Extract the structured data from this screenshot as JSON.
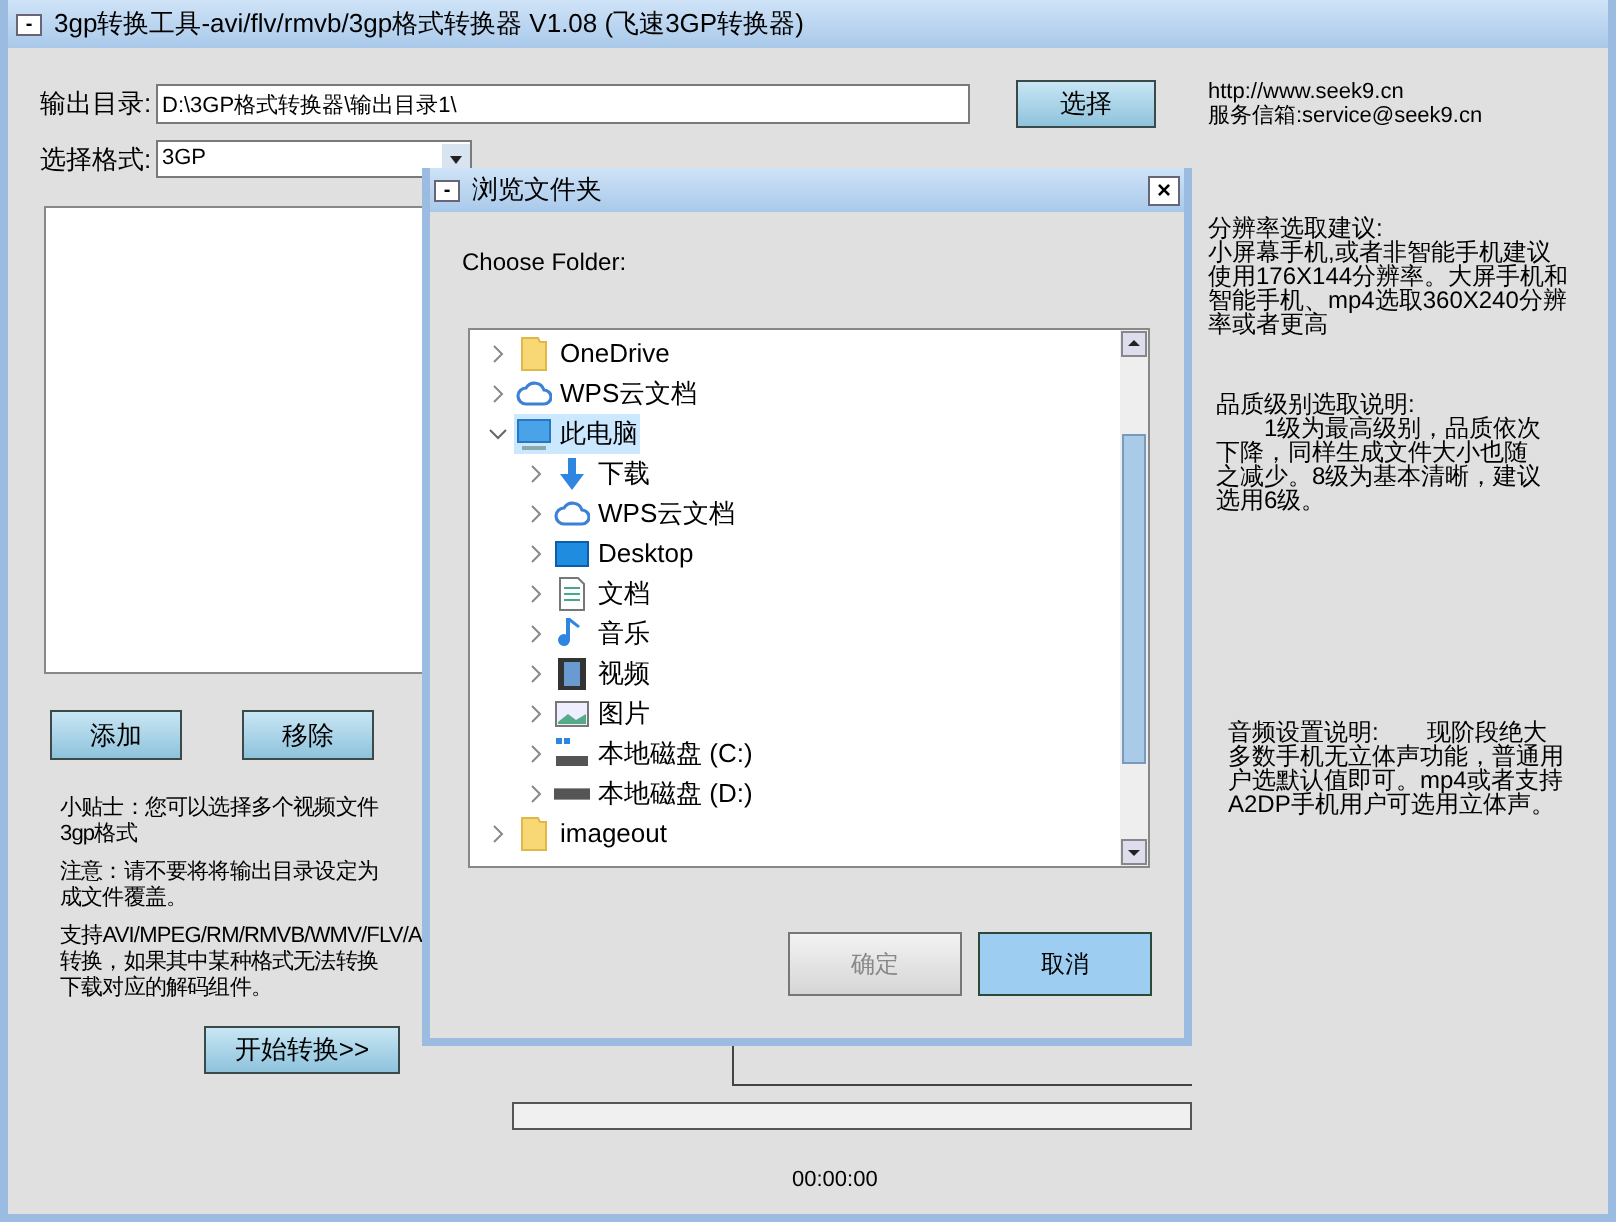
{
  "window": {
    "title": "3gp转换工具-avi/flv/rmvb/3gp格式转换器 V1.08 (飞速3GP转换器)",
    "menu_glyph": "-"
  },
  "output_dir": {
    "label": "输出目录:",
    "value": "D:\\3GP格式转换器\\输出目录1\\",
    "button": "选择"
  },
  "format": {
    "label": "选择格式:",
    "value": "3GP"
  },
  "list_buttons": [
    "添加",
    "移除"
  ],
  "tips": [
    {
      "lines": [
        "小贴士：您可以选择多个视频文件",
        "3gp格式"
      ]
    },
    {
      "lines": [
        "注意：请不要将将输出目录设定为",
        "成文件覆盖。"
      ]
    },
    {
      "lines": [
        "支持AVI/MPEG/RM/RMVB/WMV/FLV/A",
        "转换，如果其中某种格式无法转换",
        "下载对应的解码组件。"
      ]
    }
  ],
  "start_button": "开始转换>>",
  "progress": {
    "level": 0
  },
  "time": "00:00:00",
  "contact": [
    "http://www.seek9.cn",
    "服务信箱:service@seek9.cn"
  ],
  "notes": [
    {
      "lines": [
        "分辨率选取建议:",
        "小屏幕手机,或者非智能手机建议",
        "使用176X144分辨率。大屏手机和",
        "智能手机、mp4选取360X240分辨",
        "率或者更高"
      ]
    },
    {
      "lines": [
        "品质级别选取说明:",
        "　　1级为最高级别，品质依次",
        "下降，同样生成文件大小也随",
        "之减少。8级为基本清晰，建议",
        "选用6级。"
      ]
    },
    {
      "lines": [
        "音频设置说明:　　现阶段绝大",
        "多数手机无立体声功能，普通用",
        "户选默认值即可。mp4或者支持",
        "A2DP手机用户可选用立体声。"
      ]
    }
  ],
  "dialog": {
    "title": "浏览文件夹",
    "menu_glyph": "-",
    "close": "×",
    "prompt": "Choose Folder:",
    "tree": [
      {
        "label": "OneDrive",
        "kind": "folder",
        "expanded": false,
        "selected": false
      },
      {
        "label": "WPS云文档",
        "kind": "cloud",
        "expanded": false,
        "selected": false
      },
      {
        "label": "此电脑",
        "kind": "computer",
        "expanded": true,
        "selected": true,
        "children": [
          {
            "label": "下载",
            "kind": "download",
            "expanded": false,
            "selected": false
          },
          {
            "label": "WPS云文档",
            "kind": "cloud",
            "expanded": false,
            "selected": false
          },
          {
            "label": "Desktop",
            "kind": "desktop",
            "expanded": false,
            "selected": false
          },
          {
            "label": "文档",
            "kind": "document",
            "expanded": false,
            "selected": false
          },
          {
            "label": "音乐",
            "kind": "music",
            "expanded": false,
            "selected": false
          },
          {
            "label": "视频",
            "kind": "video",
            "expanded": false,
            "selected": false
          },
          {
            "label": "图片",
            "kind": "image",
            "expanded": false,
            "selected": false
          },
          {
            "label": "本地磁盘 (C:)",
            "kind": "system-drive",
            "expanded": false,
            "selected": false
          },
          {
            "label": "本地磁盘 (D:)",
            "kind": "drive",
            "expanded": false,
            "selected": false
          }
        ]
      },
      {
        "label": "imageout",
        "kind": "folder",
        "expanded": false,
        "selected": false
      }
    ],
    "buttons": [
      {
        "label": "确定",
        "disabled": true,
        "focused": false
      },
      {
        "label": "取消",
        "disabled": false,
        "focused": true
      }
    ]
  }
}
